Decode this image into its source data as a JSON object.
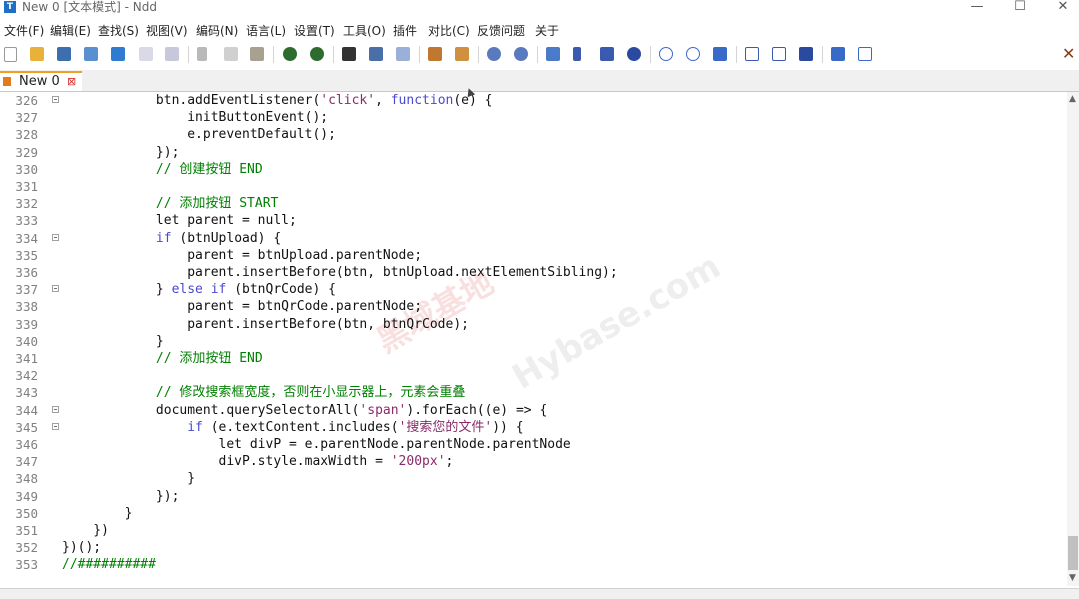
{
  "window": {
    "title": "New 0 [文本模式] - Ndd",
    "icon_text": "T",
    "min": "—",
    "max": "☐",
    "close": "✕"
  },
  "menu": [
    "文件(F)",
    "编辑(E)",
    "查找(S)",
    "视图(V)",
    "编码(N)",
    "语言(L)",
    "设置(T)",
    "工具(O)",
    "插件",
    "对比(C)",
    "反馈问题",
    "关于"
  ],
  "toolbar": {
    "close_glyph": "✕"
  },
  "tab": {
    "label": "New 0",
    "close": "⊠"
  },
  "editor": {
    "lines": [
      {
        "n": "326",
        "fold": true,
        "code": "            btn.addEventListener('click', function(e) {"
      },
      {
        "n": "327",
        "fold": false,
        "code": "                initButtonEvent();"
      },
      {
        "n": "328",
        "fold": false,
        "code": "                e.preventDefault();"
      },
      {
        "n": "329",
        "fold": false,
        "code": "            });"
      },
      {
        "n": "330",
        "fold": false,
        "code": "            // 创建按钮 END"
      },
      {
        "n": "331",
        "fold": false,
        "code": ""
      },
      {
        "n": "332",
        "fold": false,
        "code": "            // 添加按钮 START"
      },
      {
        "n": "333",
        "fold": false,
        "code": "            let parent = null;"
      },
      {
        "n": "334",
        "fold": true,
        "code": "            if (btnUpload) {"
      },
      {
        "n": "335",
        "fold": false,
        "code": "                parent = btnUpload.parentNode;"
      },
      {
        "n": "336",
        "fold": false,
        "code": "                parent.insertBefore(btn, btnUpload.nextElementSibling);"
      },
      {
        "n": "337",
        "fold": true,
        "code": "            } else if (btnQrCode) {"
      },
      {
        "n": "338",
        "fold": false,
        "code": "                parent = btnQrCode.parentNode;"
      },
      {
        "n": "339",
        "fold": false,
        "code": "                parent.insertBefore(btn, btnQrCode);"
      },
      {
        "n": "340",
        "fold": false,
        "code": "            }"
      },
      {
        "n": "341",
        "fold": false,
        "code": "            // 添加按钮 END"
      },
      {
        "n": "342",
        "fold": false,
        "code": ""
      },
      {
        "n": "343",
        "fold": false,
        "code": "            // 修改搜索框宽度，否则在小显示器上，元素会重叠"
      },
      {
        "n": "344",
        "fold": true,
        "code": "            document.querySelectorAll('span').forEach((e) => {"
      },
      {
        "n": "345",
        "fold": true,
        "code": "                if (e.textContent.includes('搜索您的文件')) {"
      },
      {
        "n": "346",
        "fold": false,
        "code": "                    let divP = e.parentNode.parentNode.parentNode"
      },
      {
        "n": "347",
        "fold": false,
        "code": "                    divP.style.maxWidth = '200px';"
      },
      {
        "n": "348",
        "fold": false,
        "code": "                }"
      },
      {
        "n": "349",
        "fold": false,
        "code": "            });"
      },
      {
        "n": "350",
        "fold": false,
        "code": "        }"
      },
      {
        "n": "351",
        "fold": false,
        "code": "    })"
      },
      {
        "n": "352",
        "fold": false,
        "code": "})();"
      },
      {
        "n": "353",
        "fold": false,
        "code": "//##########"
      }
    ]
  },
  "watermarks": {
    "cn": "黑域基地",
    "en": "Hybase.com"
  },
  "scroll": {
    "up": "▲",
    "down": "▼"
  },
  "colors": {
    "string": "#8a2a6a",
    "keyword": "#4a4ad0",
    "comment": "#008000",
    "tab_accent": "#f0a020"
  }
}
